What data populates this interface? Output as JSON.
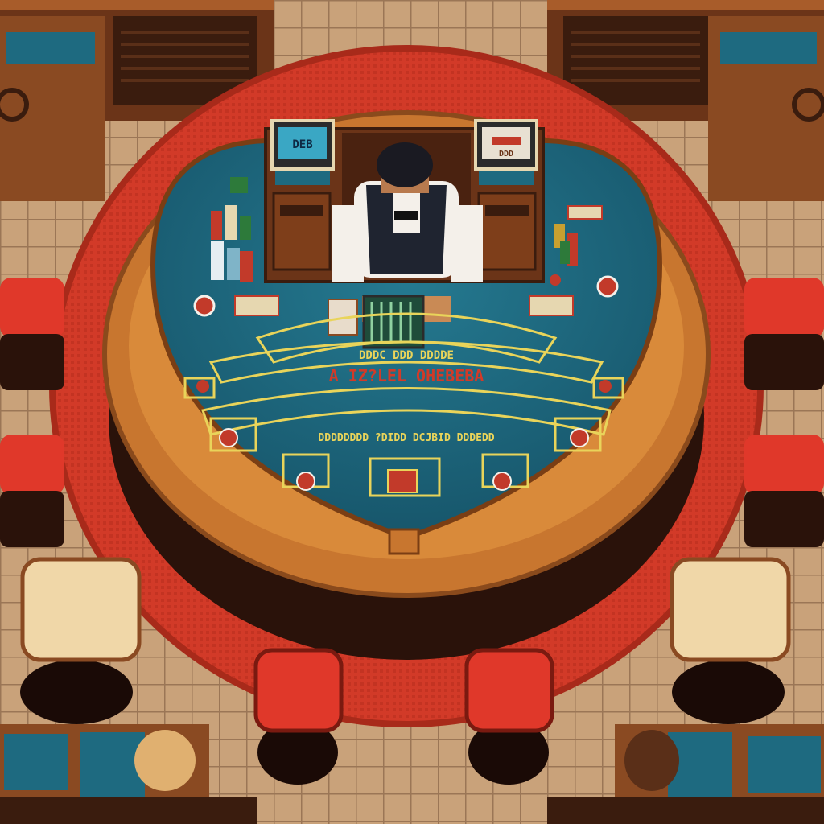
{
  "scene": {
    "type": "pixel-art casino floor, top-down view",
    "table_game": "blackjack"
  },
  "table_text": {
    "main_arc_text": "A IZ?LEL OHEBEBA",
    "inner_arc_text": "DDDC DDD DDDDE",
    "outer_arc_text": "DDDDDDDD ?DIDD DCJBID DDDEDD"
  },
  "monitors": {
    "left_screen_text": "DEB",
    "right_screen_text": "DDD"
  },
  "colors": {
    "felt": "#1e6a80",
    "rail": "#c8762f",
    "carpet": "#d23a28",
    "floor": "#c9a27a",
    "chair": "#e0382a",
    "table_lines": "#e9d45a"
  },
  "player_seats": 7,
  "dealer": {
    "present": true,
    "attire": "white shirt, black vest, bow tie"
  }
}
